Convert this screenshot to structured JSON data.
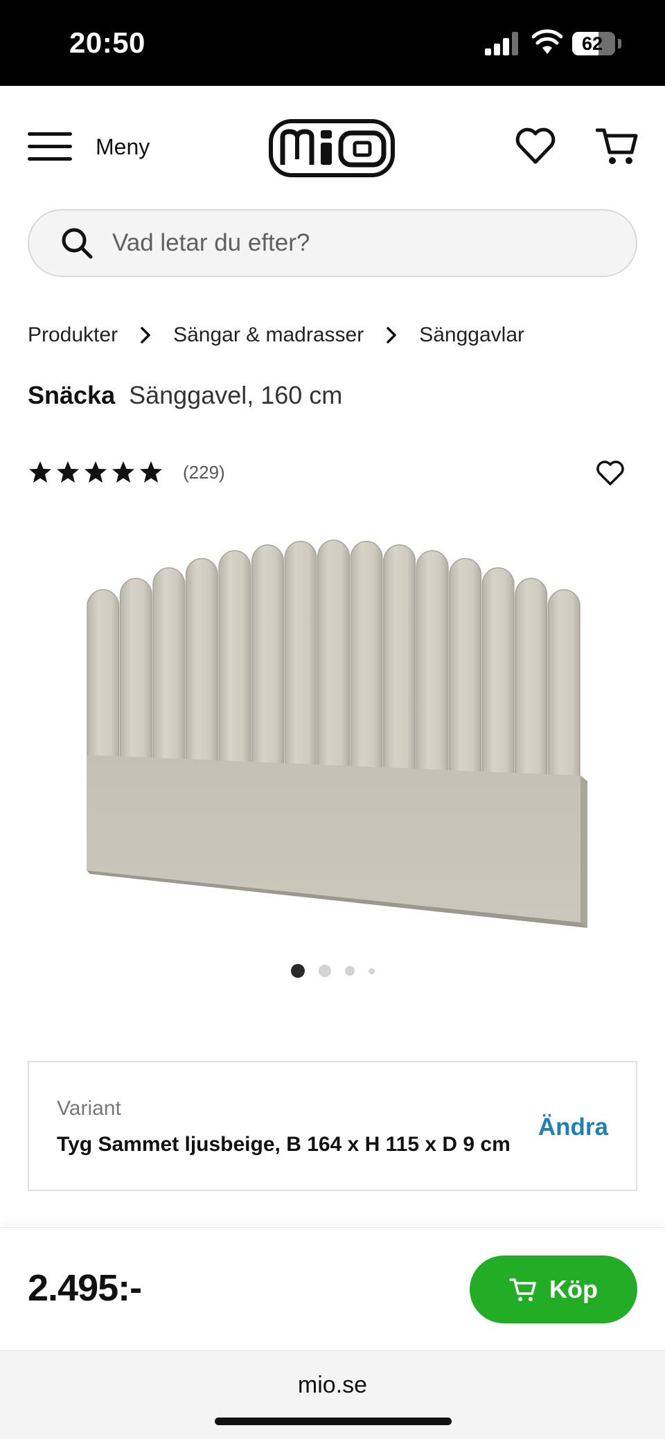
{
  "status_bar": {
    "time": "20:50",
    "battery": "62",
    "battery_level": 0.62
  },
  "header": {
    "menu_label": "Meny",
    "logo_text": "mio"
  },
  "search": {
    "placeholder": "Vad letar du efter?"
  },
  "breadcrumb": [
    "Produkter",
    "Sängar & madrasser",
    "Sänggavlar"
  ],
  "product": {
    "name": "Snäcka",
    "subtitle": "Sänggavel, 160 cm",
    "rating_stars": 5,
    "rating_count": "(229)"
  },
  "carousel": {
    "total": 4,
    "active": 1
  },
  "variant": {
    "label": "Variant",
    "value": "Tyg Sammet ljusbeige, B 164 x H 115 x D 9 cm",
    "change_label": "Ändra"
  },
  "purchase": {
    "price": "2.495:-",
    "buy_label": "Köp",
    "button_color": "#23ad27"
  },
  "browser": {
    "url": "mio.se"
  },
  "colors": {
    "accent_link": "#1f7fb6",
    "upholstery": "#cfcbc0"
  }
}
